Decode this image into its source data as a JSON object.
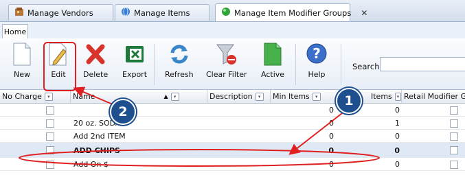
{
  "tabs": [
    {
      "label": "Manage Vendors"
    },
    {
      "label": "Manage Items"
    },
    {
      "label": "Manage Item Modifier Groups"
    }
  ],
  "ribbon_tab": "Home",
  "toolbar": {
    "new_label": "New",
    "edit_label": "Edit",
    "delete_label": "Delete",
    "export_label": "Export",
    "refresh_label": "Refresh",
    "clear_filter_label": "Clear Filter",
    "active_label": "Active",
    "help_label": "Help"
  },
  "search": {
    "label": "Search:",
    "value": ""
  },
  "columns": {
    "no_charge": "No Charge",
    "name": "Name",
    "description": "Description",
    "min_items": "Min Items",
    "max_items": "Items",
    "retail_modifier": "Retail Modifier G"
  },
  "rows": [
    {
      "name": "",
      "min": "0",
      "max": "0"
    },
    {
      "name": "20 oz. SODA",
      "min": "0",
      "max": "1"
    },
    {
      "name": "Add 2nd ITEM",
      "min": "0",
      "max": "0"
    },
    {
      "name": "ADD CHIPS",
      "min": "0",
      "max": "0"
    },
    {
      "name": "Add On $",
      "min": "0",
      "max": "0"
    }
  ],
  "annotations": {
    "step1": "1",
    "step2": "2"
  },
  "colors": {
    "annotation_red": "#e02020",
    "badge_blue": "#1e4f8f"
  }
}
